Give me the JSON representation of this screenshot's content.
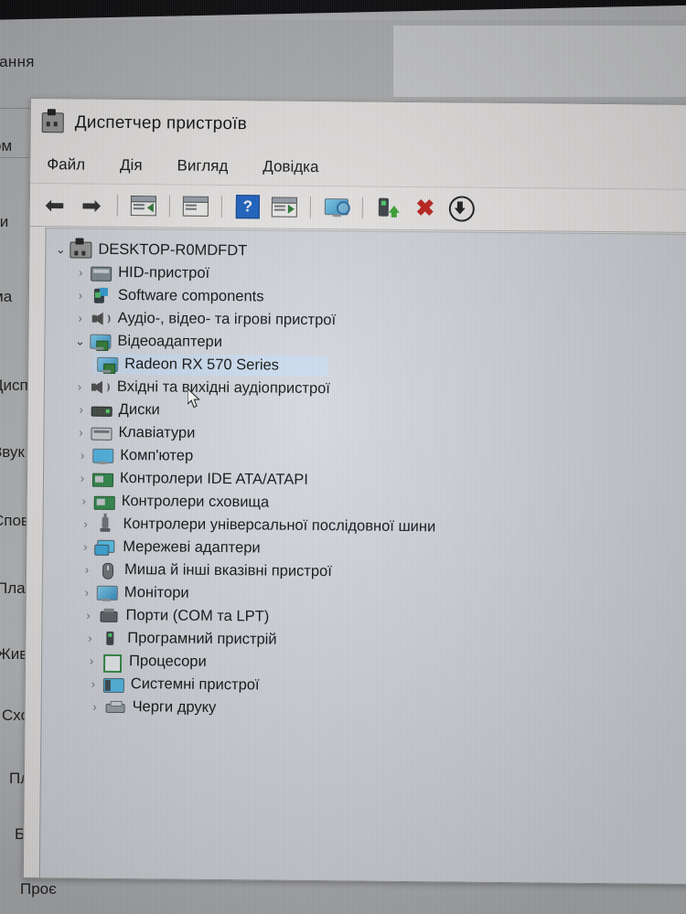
{
  "window": {
    "title": "Диспетчер пристроїв",
    "title_icon": "device-manager-icon"
  },
  "menu": {
    "items": [
      {
        "label": "Файл",
        "name": "menu-file"
      },
      {
        "label": "Дія",
        "name": "menu-action"
      },
      {
        "label": "Вигляд",
        "name": "menu-view"
      },
      {
        "label": "Довідка",
        "name": "menu-help"
      }
    ]
  },
  "toolbar": {
    "buttons": [
      {
        "name": "back-button",
        "icon": "back-arrow-icon",
        "glyph": "⬅"
      },
      {
        "name": "forward-button",
        "icon": "forward-arrow-icon",
        "glyph": "➡"
      },
      {
        "name": "show-hide-tree-button",
        "icon": "tree-view-icon"
      },
      {
        "name": "properties-button",
        "icon": "properties-icon"
      },
      {
        "name": "help-button",
        "icon": "help-question-icon",
        "glyph": "?"
      },
      {
        "name": "scan-hardware-changes-button",
        "icon": "scan-play-icon"
      },
      {
        "name": "display-button",
        "icon": "monitor-search-icon"
      },
      {
        "name": "update-driver-button",
        "icon": "install-driver-icon"
      },
      {
        "name": "uninstall-device-button",
        "icon": "red-x-icon",
        "glyph": "✖"
      },
      {
        "name": "disable-device-button",
        "icon": "down-arrow-circle-icon"
      }
    ]
  },
  "tree": {
    "root": {
      "label": "DESKTOP-R0MDFDT",
      "icon": "computer-root-icon",
      "expanded": true
    },
    "nodes": [
      {
        "label": "HID-пристрої",
        "icon": "hid-icon",
        "indent": 1,
        "expanded": false,
        "selected": false
      },
      {
        "label": "Software components",
        "icon": "software-component-icon",
        "indent": 1,
        "expanded": false,
        "selected": false
      },
      {
        "label": "Аудіо-, відео- та ігрові пристрої",
        "icon": "speaker-icon",
        "indent": 1,
        "expanded": false,
        "selected": false
      },
      {
        "label": "Відеоадаптери",
        "icon": "display-adapter-icon",
        "indent": 1,
        "expanded": true,
        "selected": false
      },
      {
        "label": "Radeon RX 570 Series",
        "icon": "display-adapter-icon",
        "indent": 2,
        "expanded": null,
        "selected": true
      },
      {
        "label": "Вхідні та вихідні аудіопристрої",
        "icon": "speaker-icon",
        "indent": 1,
        "expanded": false,
        "selected": false
      },
      {
        "label": "Диски",
        "icon": "disk-drive-icon",
        "indent": 1,
        "expanded": false,
        "selected": false
      },
      {
        "label": "Клавіатури",
        "icon": "keyboard-icon",
        "indent": 1,
        "expanded": false,
        "selected": false
      },
      {
        "label": "Комп'ютер",
        "icon": "computer-icon",
        "indent": 1,
        "expanded": false,
        "selected": false
      },
      {
        "label": "Контролери IDE ATA/ATAPI",
        "icon": "ide-controller-icon",
        "indent": 1,
        "expanded": false,
        "selected": false
      },
      {
        "label": "Контролери сховища",
        "icon": "storage-controller-icon",
        "indent": 1,
        "expanded": false,
        "selected": false
      },
      {
        "label": "Контролери універсальної послідовної шини",
        "icon": "usb-controller-icon",
        "indent": 1,
        "expanded": false,
        "selected": false
      },
      {
        "label": "Мережеві адаптери",
        "icon": "network-adapter-icon",
        "indent": 1,
        "expanded": false,
        "selected": false
      },
      {
        "label": "Миша й інші вказівні пристрої",
        "icon": "mouse-icon",
        "indent": 1,
        "expanded": false,
        "selected": false
      },
      {
        "label": "Монітори",
        "icon": "monitor-icon",
        "indent": 1,
        "expanded": false,
        "selected": false
      },
      {
        "label": "Порти (COM та LPT)",
        "icon": "port-icon",
        "indent": 1,
        "expanded": false,
        "selected": false
      },
      {
        "label": "Програмний пристрій",
        "icon": "software-device-icon",
        "indent": 1,
        "expanded": false,
        "selected": false
      },
      {
        "label": "Процесори",
        "icon": "processor-icon",
        "indent": 1,
        "expanded": false,
        "selected": false
      },
      {
        "label": "Системні пристрої",
        "icon": "system-device-icon",
        "indent": 1,
        "expanded": false,
        "selected": false
      },
      {
        "label": "Черги друку",
        "icon": "print-queue-icon",
        "indent": 1,
        "expanded": false,
        "selected": false
      }
    ],
    "chevron_collapsed": "›",
    "chevron_expanded": "⌄"
  },
  "background_window": {
    "header": "вання",
    "items": [
      {
        "label": "ом",
        "name": "bg-item-1"
      },
      {
        "label": "ти",
        "name": "bg-item-2"
      },
      {
        "label": "ма",
        "name": "bg-item-3"
      },
      {
        "label": "Дисп",
        "name": "bg-item-4"
      },
      {
        "label": "Звук",
        "name": "bg-item-5"
      },
      {
        "label": "Спов",
        "name": "bg-item-6"
      },
      {
        "label": "План",
        "name": "bg-item-7"
      },
      {
        "label": "Живл",
        "name": "bg-item-8"
      },
      {
        "label": "Схов",
        "name": "bg-item-9"
      },
      {
        "label": "План",
        "name": "bg-item-10"
      },
      {
        "label": "Багат",
        "name": "bg-item-11"
      },
      {
        "label": "Проє",
        "name": "bg-item-12"
      }
    ]
  },
  "colors": {
    "window_chrome": "#eceae9",
    "tree_background": "#d7dae1",
    "selection": "#cfe0f3",
    "accent_blue": "#1963c7",
    "danger_red": "#c2201c",
    "desktop": "#b6b8ba"
  }
}
